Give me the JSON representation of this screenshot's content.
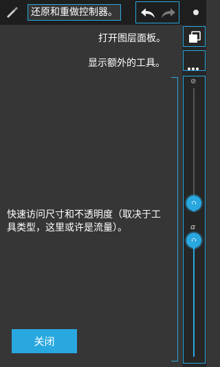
{
  "hints": {
    "undo_redo": "还原和重做控制器。",
    "layers": "打开图层面板。",
    "extra_tools": "显示额外的工具。",
    "size_opacity": "快速访问尺寸和不透明度（取决于工具类型，这里或许是流量）。"
  },
  "close_button": {
    "label": "关闭"
  },
  "sliders": {
    "size": {
      "glyph": "⊘",
      "value": 0.15
    },
    "opacity": {
      "glyph": "α",
      "value": 0.95
    }
  },
  "colors": {
    "accent": "#29a8e0",
    "background": "#363636",
    "panel": "#262626"
  },
  "icons": [
    "brush-icon",
    "undo-icon",
    "redo-icon",
    "layers-icon",
    "more-icon",
    "menu-icon"
  ]
}
